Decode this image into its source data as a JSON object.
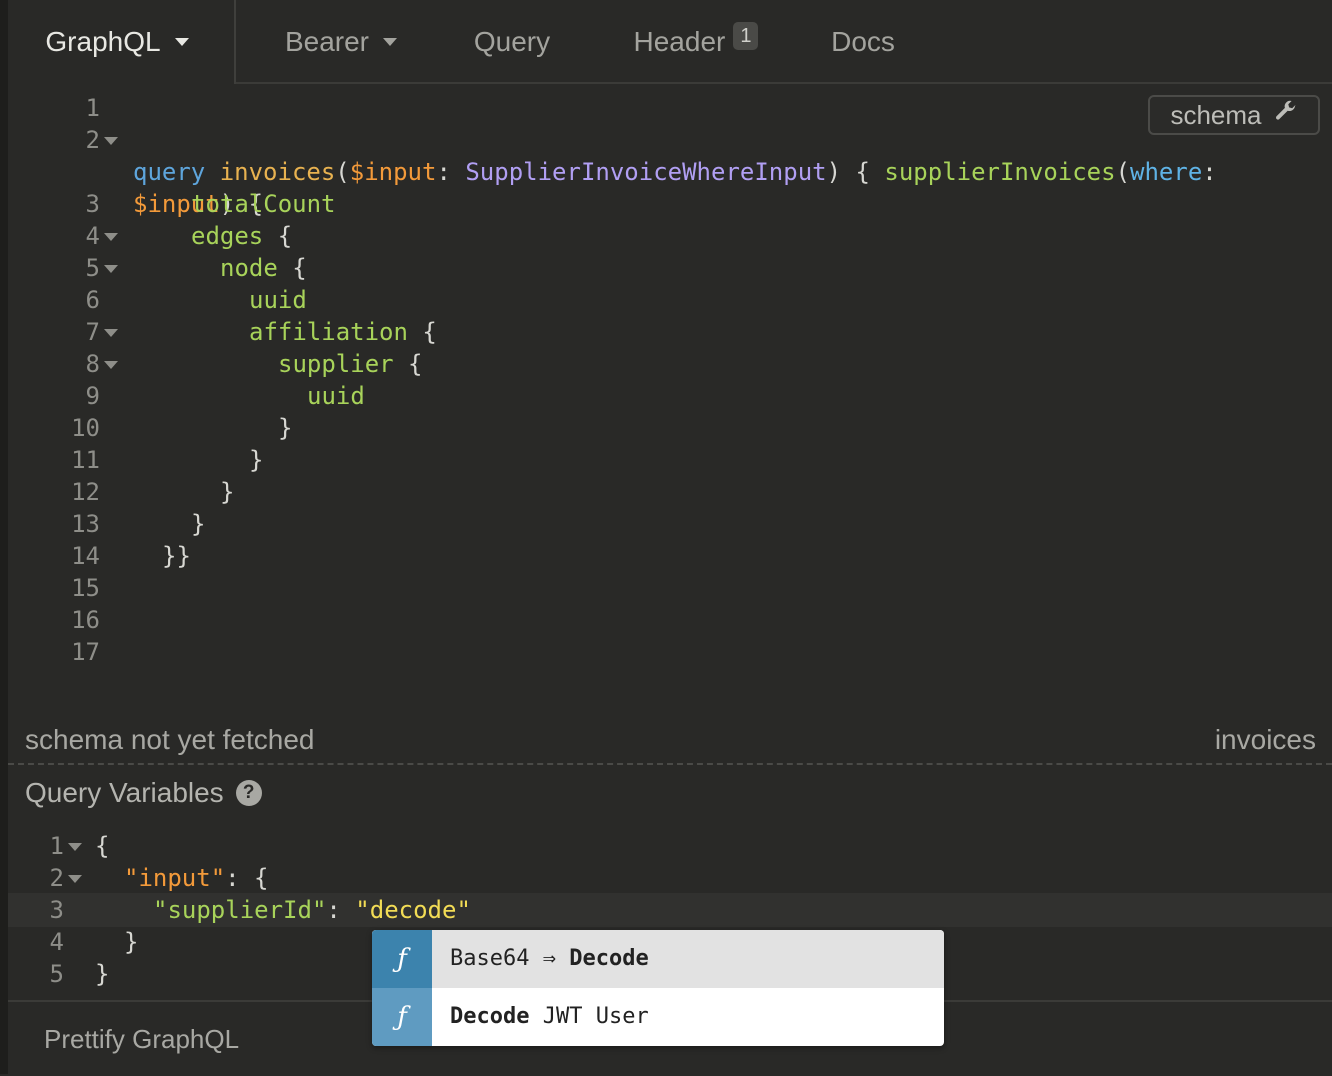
{
  "tabs": {
    "graphql": "GraphQL",
    "bearer": "Bearer",
    "query": "Query",
    "header": "Header",
    "header_badge": "1",
    "docs": "Docs"
  },
  "schema_button": {
    "label": "schema",
    "icon": "wrench-icon"
  },
  "editor": {
    "line_numbers": [
      "1",
      "2",
      "3",
      "4",
      "5",
      "6",
      "7",
      "8",
      "9",
      "10",
      "11",
      "12",
      "13",
      "14",
      "15",
      "16",
      "17"
    ],
    "foldable_lines": [
      "2",
      "4",
      "5",
      "7",
      "8"
    ],
    "line2a": {
      "kw": "query",
      "name": "invoices",
      "p1": "(",
      "var": "$input",
      "p2": ": ",
      "type": "SupplierInvoiceWhereInput",
      "p3": ") { ",
      "field": "supplierInvoices",
      "p4": "(",
      "arg": "where",
      "p5": ":"
    },
    "line2b": {
      "var": "$input",
      "p": ") {"
    },
    "l3": "totalCount",
    "l4": "edges",
    "l5": "node",
    "l6": "uuid",
    "l7": "affiliation",
    "l8": "supplier",
    "l9": "uuid",
    "open_brace": " {",
    "close_brace": "}",
    "l14": "}}"
  },
  "status": {
    "left": "schema not yet fetched",
    "right": "invoices"
  },
  "query_variables": {
    "title": "Query Variables",
    "line_numbers": [
      "1",
      "2",
      "3",
      "4",
      "5"
    ],
    "foldable_lines": [
      "1",
      "2"
    ],
    "l1": "{",
    "l2_key": "\"input\"",
    "l2_rest": ": {",
    "l3_key": "\"supplierId\"",
    "l3_colon": ": ",
    "l3_val": "\"decode\"",
    "l4": "}",
    "l5": "}"
  },
  "autocomplete": [
    {
      "icon": "function-icon",
      "glyph": "ƒ",
      "prefix": "Base64 ⇒ ",
      "bold": "Decode",
      "suffix": ""
    },
    {
      "icon": "function-icon",
      "glyph": "ƒ",
      "prefix": "",
      "bold": "Decode",
      "suffix": " JWT User"
    }
  ],
  "footer": {
    "prettify": "Prettify GraphQL"
  }
}
